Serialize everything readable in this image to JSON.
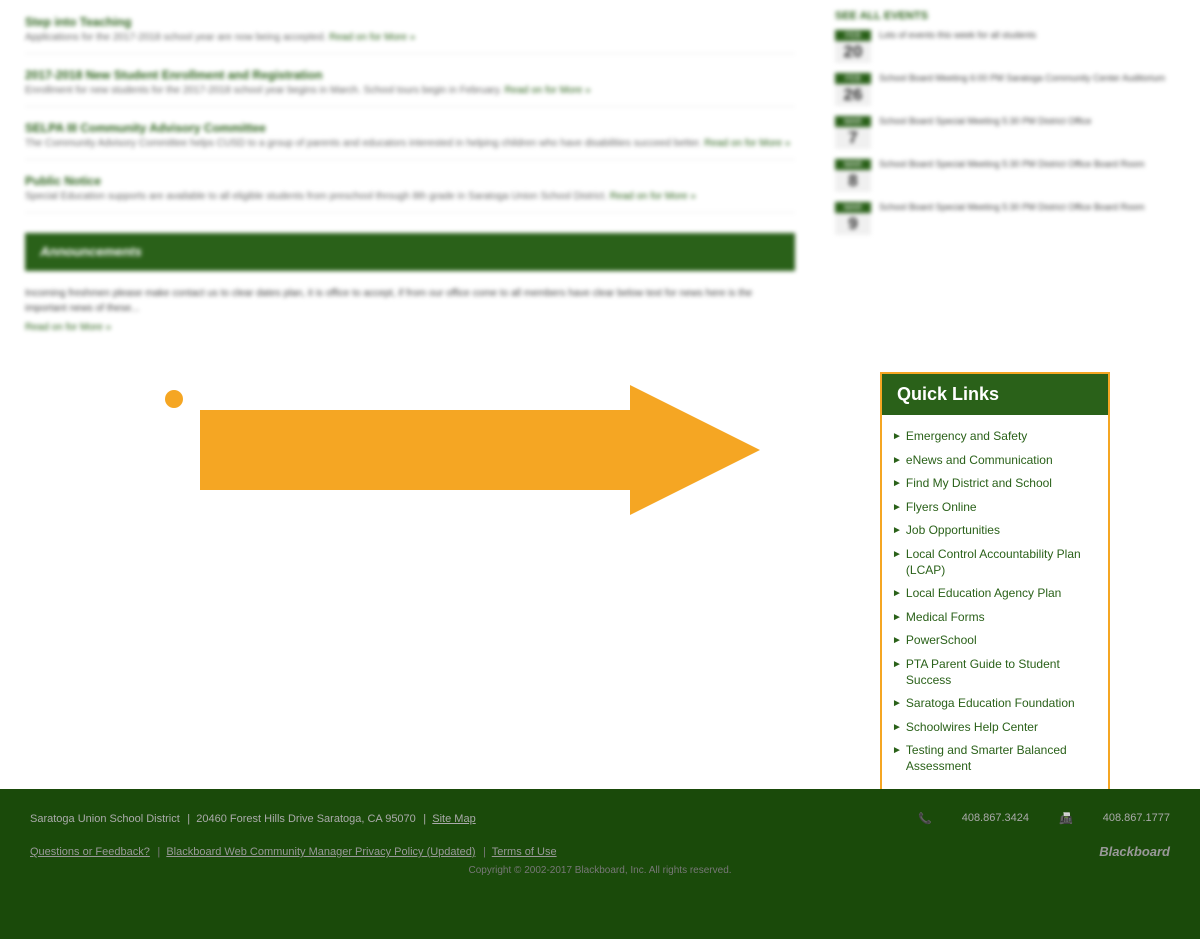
{
  "quicklinks": {
    "title": "Quick Links",
    "items": [
      {
        "label": "Emergency and Safety",
        "id": "emergency-safety"
      },
      {
        "label": "eNews and Communication",
        "id": "enews-communication"
      },
      {
        "label": "Find My District and School",
        "id": "find-district-school"
      },
      {
        "label": "Flyers Online",
        "id": "flyers-online"
      },
      {
        "label": "Job Opportunities",
        "id": "job-opportunities"
      },
      {
        "label": "Local Control Accountability Plan (LCAP)",
        "id": "lcap"
      },
      {
        "label": "Local Education Agency Plan",
        "id": "lea-plan"
      },
      {
        "label": "Medical Forms",
        "id": "medical-forms"
      },
      {
        "label": "PowerSchool",
        "id": "powerschool"
      },
      {
        "label": "PTA Parent Guide to Student Success",
        "id": "pta-guide"
      },
      {
        "label": "Saratoga Education Foundation",
        "id": "saratoga-edu"
      },
      {
        "label": "Schoolwires Help Center",
        "id": "schoolwires-help"
      },
      {
        "label": "Testing and Smarter Balanced Assessment",
        "id": "testing-smarter"
      }
    ]
  },
  "news": [
    {
      "title": "Step into Teaching",
      "body": "Applications for the 2017-2018 school year are now being accepted. Read on for More »"
    },
    {
      "title": "2017-2018 New Student Enrollment and Registration",
      "body": "Enrollment for new students for the 2017-2018 school year begins in March. School tours begin in February. Read on for More »"
    },
    {
      "title": "SELPA III Community Advisory Committee",
      "body": "The Community Advisory Committee helps CUSD to a group of parents and educators interested in helping children who have disabilities succeed better. Read on for More »"
    },
    {
      "title": "Public Notice",
      "body": "Special Education supports are available to all eligible students from preschool through 8th grade in Saratoga Union School District. Read on for More »"
    }
  ],
  "announcements": {
    "label": "Announcements",
    "text": "Incoming freshmen please make contact us to clear dates plan, it is office to accept, if from our office come to all members have clear below text for news here is the important news of these..."
  },
  "calendar": {
    "items": [
      {
        "month": "FEB",
        "day": "20",
        "desc": "Lots of events this week for all"
      },
      {
        "month": "FEB",
        "day": "26",
        "desc": "School Board Meeting 6:00 PM Saratoga Community"
      },
      {
        "month": "MAR",
        "day": "7",
        "desc": "School Board Special Meeting 5:30 PM"
      },
      {
        "month": "MAR",
        "day": "8",
        "desc": "School Board Special Meeting 5:30 PM District Office"
      },
      {
        "month": "MAR",
        "day": "9",
        "desc": "School Board Special Meeting 5:30 PM District Office"
      }
    ]
  },
  "footer": {
    "district_name": "Saratoga Union School District",
    "address": "20460 Forest Hills Drive Saratoga, CA 95070",
    "site_map": "Site Map",
    "phone1": "408.867.3424",
    "phone2": "408.867.1777",
    "questions_label": "Questions or Feedback?",
    "privacy_label": "Blackboard Web Community Manager Privacy Policy (Updated)",
    "terms_label": "Terms of Use",
    "copyright": "Copyright © 2002-2017 Blackboard, Inc. All rights reserved.",
    "blackboard_label": "Blackboard"
  }
}
